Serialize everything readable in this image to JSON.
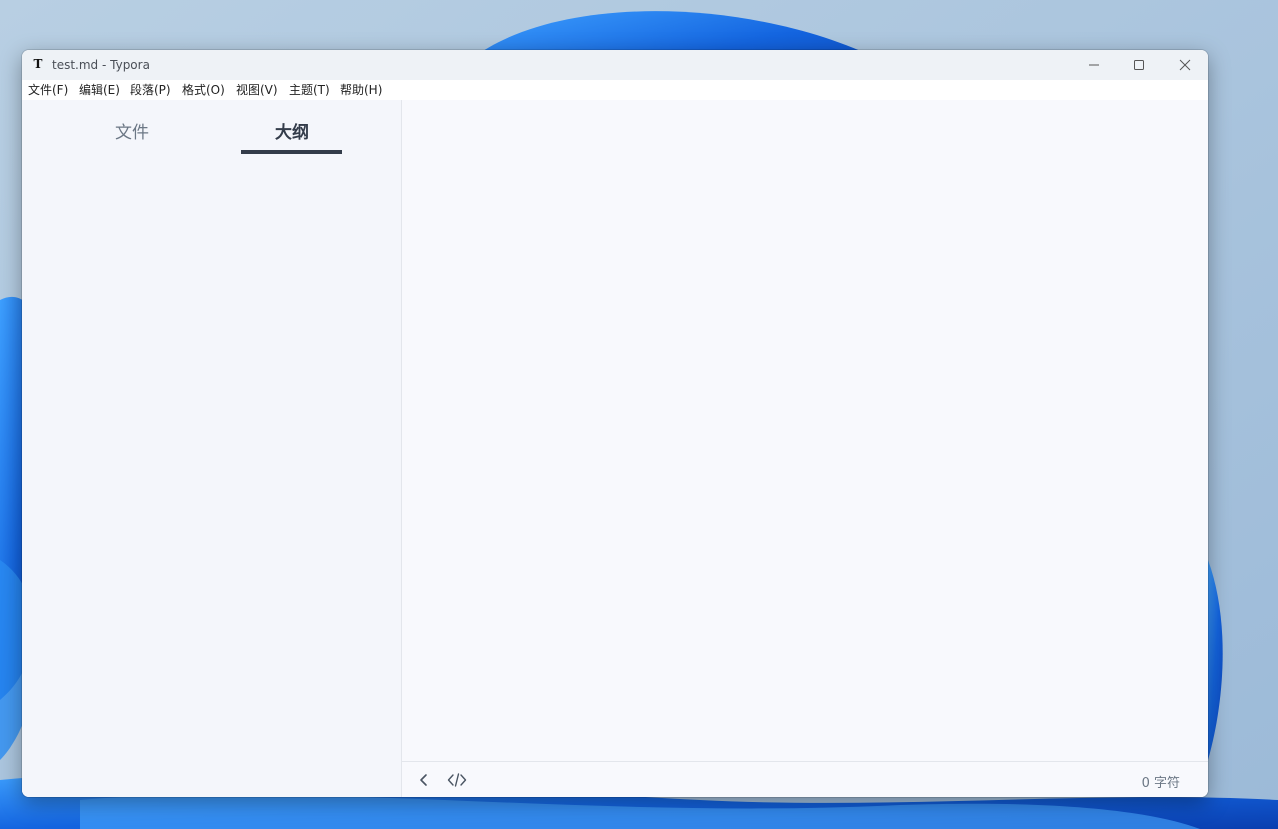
{
  "window": {
    "title": "test.md - Typora",
    "app_icon_glyph": "T"
  },
  "menubar": {
    "items": [
      "文件(F)",
      "编辑(E)",
      "段落(P)",
      "格式(O)",
      "视图(V)",
      "主题(T)",
      "帮助(H)"
    ]
  },
  "sidebar": {
    "tabs": [
      {
        "label": "文件",
        "active": false
      },
      {
        "label": "大纲",
        "active": true
      }
    ]
  },
  "footer": {
    "toggle_sidebar_icon": "chevron-left-icon",
    "source_mode_icon": "code-icon",
    "word_count": "0 字符"
  },
  "colors": {
    "accent": "#333c4a",
    "wallpaper_blue": "#1a6fe0"
  }
}
